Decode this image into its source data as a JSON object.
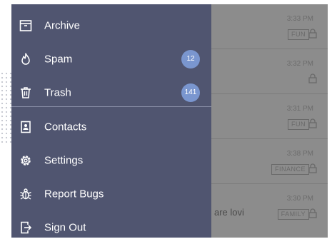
{
  "drawer": {
    "items": [
      {
        "label": "Archive",
        "icon": "archive-icon"
      },
      {
        "label": "Spam",
        "icon": "fire-icon",
        "badge": "12"
      },
      {
        "label": "Trash",
        "icon": "trash-icon",
        "badge": "141"
      },
      {
        "label": "Contacts",
        "icon": "contacts-icon"
      },
      {
        "label": "Settings",
        "icon": "gear-icon"
      },
      {
        "label": "Report Bugs",
        "icon": "bug-icon"
      },
      {
        "label": "Sign Out",
        "icon": "sign-out-icon"
      }
    ]
  },
  "messages": [
    {
      "time": "3:33 PM",
      "tag": "FUN",
      "snippet": ""
    },
    {
      "time": "3:32 PM",
      "tag": "",
      "snippet": ""
    },
    {
      "time": "3:31 PM",
      "tag": "FUN",
      "snippet": ""
    },
    {
      "time": "3:38 PM",
      "tag": "FINANCE",
      "snippet": ""
    },
    {
      "time": "3:30 PM",
      "tag": "FAMILY",
      "snippet": "are lovi"
    }
  ],
  "colors": {
    "drawer_bg": "#505570",
    "badge_bg": "#7a96cf",
    "overlay": "#8c8c8c"
  }
}
